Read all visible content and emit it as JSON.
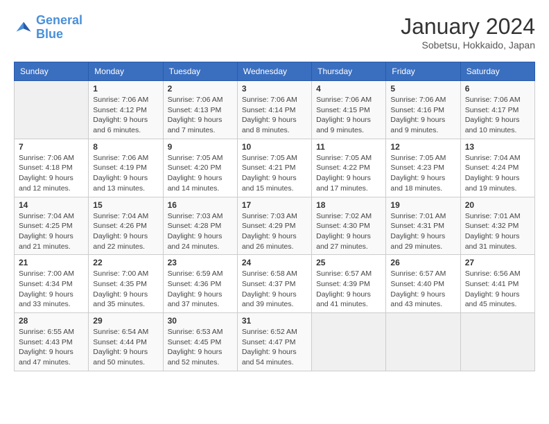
{
  "header": {
    "logo_line1": "General",
    "logo_line2": "Blue",
    "title": "January 2024",
    "subtitle": "Sobetsu, Hokkaido, Japan"
  },
  "columns": [
    "Sunday",
    "Monday",
    "Tuesday",
    "Wednesday",
    "Thursday",
    "Friday",
    "Saturday"
  ],
  "weeks": [
    [
      {
        "day": "",
        "info": ""
      },
      {
        "day": "1",
        "info": "Sunrise: 7:06 AM\nSunset: 4:12 PM\nDaylight: 9 hours\nand 6 minutes."
      },
      {
        "day": "2",
        "info": "Sunrise: 7:06 AM\nSunset: 4:13 PM\nDaylight: 9 hours\nand 7 minutes."
      },
      {
        "day": "3",
        "info": "Sunrise: 7:06 AM\nSunset: 4:14 PM\nDaylight: 9 hours\nand 8 minutes."
      },
      {
        "day": "4",
        "info": "Sunrise: 7:06 AM\nSunset: 4:15 PM\nDaylight: 9 hours\nand 9 minutes."
      },
      {
        "day": "5",
        "info": "Sunrise: 7:06 AM\nSunset: 4:16 PM\nDaylight: 9 hours\nand 9 minutes."
      },
      {
        "day": "6",
        "info": "Sunrise: 7:06 AM\nSunset: 4:17 PM\nDaylight: 9 hours\nand 10 minutes."
      }
    ],
    [
      {
        "day": "7",
        "info": "Sunrise: 7:06 AM\nSunset: 4:18 PM\nDaylight: 9 hours\nand 12 minutes."
      },
      {
        "day": "8",
        "info": "Sunrise: 7:06 AM\nSunset: 4:19 PM\nDaylight: 9 hours\nand 13 minutes."
      },
      {
        "day": "9",
        "info": "Sunrise: 7:05 AM\nSunset: 4:20 PM\nDaylight: 9 hours\nand 14 minutes."
      },
      {
        "day": "10",
        "info": "Sunrise: 7:05 AM\nSunset: 4:21 PM\nDaylight: 9 hours\nand 15 minutes."
      },
      {
        "day": "11",
        "info": "Sunrise: 7:05 AM\nSunset: 4:22 PM\nDaylight: 9 hours\nand 17 minutes."
      },
      {
        "day": "12",
        "info": "Sunrise: 7:05 AM\nSunset: 4:23 PM\nDaylight: 9 hours\nand 18 minutes."
      },
      {
        "day": "13",
        "info": "Sunrise: 7:04 AM\nSunset: 4:24 PM\nDaylight: 9 hours\nand 19 minutes."
      }
    ],
    [
      {
        "day": "14",
        "info": "Sunrise: 7:04 AM\nSunset: 4:25 PM\nDaylight: 9 hours\nand 21 minutes."
      },
      {
        "day": "15",
        "info": "Sunrise: 7:04 AM\nSunset: 4:26 PM\nDaylight: 9 hours\nand 22 minutes."
      },
      {
        "day": "16",
        "info": "Sunrise: 7:03 AM\nSunset: 4:28 PM\nDaylight: 9 hours\nand 24 minutes."
      },
      {
        "day": "17",
        "info": "Sunrise: 7:03 AM\nSunset: 4:29 PM\nDaylight: 9 hours\nand 26 minutes."
      },
      {
        "day": "18",
        "info": "Sunrise: 7:02 AM\nSunset: 4:30 PM\nDaylight: 9 hours\nand 27 minutes."
      },
      {
        "day": "19",
        "info": "Sunrise: 7:01 AM\nSunset: 4:31 PM\nDaylight: 9 hours\nand 29 minutes."
      },
      {
        "day": "20",
        "info": "Sunrise: 7:01 AM\nSunset: 4:32 PM\nDaylight: 9 hours\nand 31 minutes."
      }
    ],
    [
      {
        "day": "21",
        "info": "Sunrise: 7:00 AM\nSunset: 4:34 PM\nDaylight: 9 hours\nand 33 minutes."
      },
      {
        "day": "22",
        "info": "Sunrise: 7:00 AM\nSunset: 4:35 PM\nDaylight: 9 hours\nand 35 minutes."
      },
      {
        "day": "23",
        "info": "Sunrise: 6:59 AM\nSunset: 4:36 PM\nDaylight: 9 hours\nand 37 minutes."
      },
      {
        "day": "24",
        "info": "Sunrise: 6:58 AM\nSunset: 4:37 PM\nDaylight: 9 hours\nand 39 minutes."
      },
      {
        "day": "25",
        "info": "Sunrise: 6:57 AM\nSunset: 4:39 PM\nDaylight: 9 hours\nand 41 minutes."
      },
      {
        "day": "26",
        "info": "Sunrise: 6:57 AM\nSunset: 4:40 PM\nDaylight: 9 hours\nand 43 minutes."
      },
      {
        "day": "27",
        "info": "Sunrise: 6:56 AM\nSunset: 4:41 PM\nDaylight: 9 hours\nand 45 minutes."
      }
    ],
    [
      {
        "day": "28",
        "info": "Sunrise: 6:55 AM\nSunset: 4:43 PM\nDaylight: 9 hours\nand 47 minutes."
      },
      {
        "day": "29",
        "info": "Sunrise: 6:54 AM\nSunset: 4:44 PM\nDaylight: 9 hours\nand 50 minutes."
      },
      {
        "day": "30",
        "info": "Sunrise: 6:53 AM\nSunset: 4:45 PM\nDaylight: 9 hours\nand 52 minutes."
      },
      {
        "day": "31",
        "info": "Sunrise: 6:52 AM\nSunset: 4:47 PM\nDaylight: 9 hours\nand 54 minutes."
      },
      {
        "day": "",
        "info": ""
      },
      {
        "day": "",
        "info": ""
      },
      {
        "day": "",
        "info": ""
      }
    ]
  ]
}
